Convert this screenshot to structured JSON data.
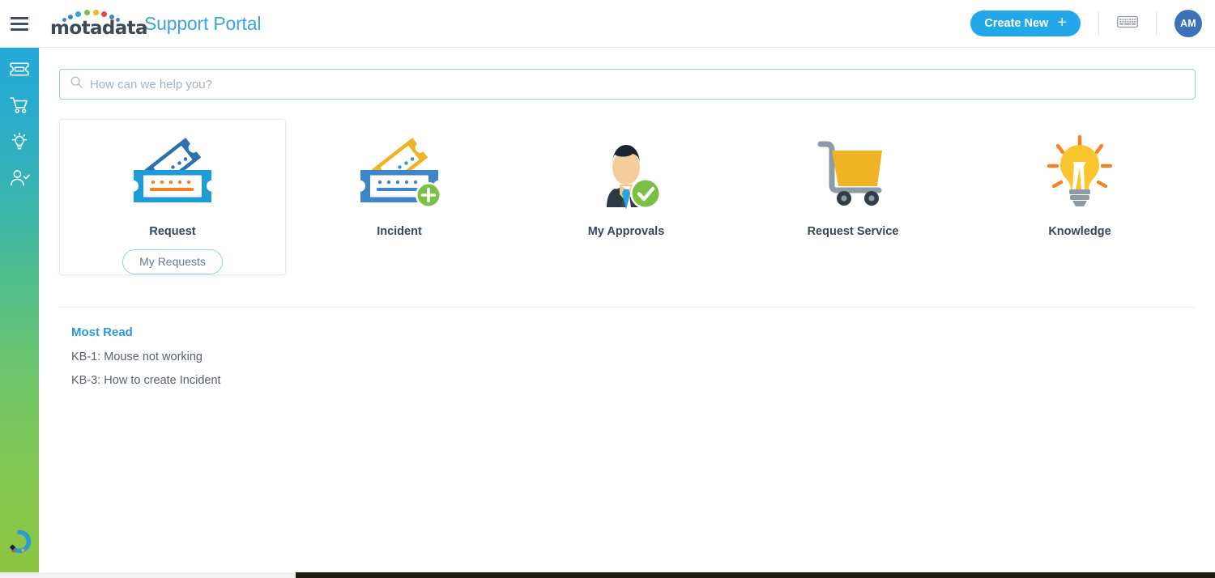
{
  "header": {
    "menu_icon": "hamburger-menu-icon",
    "logo_word": "motadata",
    "logo_dots_icon": "motadata-dots-logo-icon",
    "portal_title": "Support Portal",
    "create_new_label": "Create New",
    "create_new_plus": "+",
    "keyboard_icon": "keyboard-icon",
    "avatar_initials": "AM"
  },
  "sidebar": {
    "items": [
      {
        "name": "sidebar-item-tickets",
        "icon": "ticket-icon"
      },
      {
        "name": "sidebar-item-service-catalog",
        "icon": "shopping-cart-icon"
      },
      {
        "name": "sidebar-item-knowledge",
        "icon": "lightbulb-icon"
      },
      {
        "name": "sidebar-item-approvals",
        "icon": "user-check-icon"
      }
    ],
    "bottom_logo_icon": "motadata-circle-logo-icon"
  },
  "search": {
    "placeholder": "How can we help you?",
    "value": "",
    "icon": "search-icon"
  },
  "tiles": [
    {
      "label": "Request",
      "icon": "request-tickets-icon",
      "featured": true,
      "cta_label": "My Requests"
    },
    {
      "label": "Incident",
      "icon": "incident-ticket-plus-icon",
      "featured": false,
      "cta_label": ""
    },
    {
      "label": "My Approvals",
      "icon": "user-approval-check-icon",
      "featured": false,
      "cta_label": ""
    },
    {
      "label": "Request Service",
      "icon": "shopping-cart-icon",
      "featured": false,
      "cta_label": ""
    },
    {
      "label": "Knowledge",
      "icon": "lightbulb-idea-icon",
      "featured": false,
      "cta_label": ""
    }
  ],
  "most_read": {
    "heading": "Most Read",
    "articles": [
      "KB-1: Mouse not working",
      "KB-3: How to create Incident"
    ]
  },
  "colors": {
    "accent_blue": "#22a7e8",
    "title_blue": "#3aa3e3",
    "heading_blue": "#2b9ad6",
    "avatar_blue": "#3b72b8",
    "sidebar_top": "#24a8d8",
    "sidebar_bottom": "#8cc63f",
    "ticket_dark_blue": "#2c6fb5",
    "ticket_light_blue": "#1e9cd7",
    "ticket_yellow": "#f0b323",
    "cart_yellow": "#f0b323",
    "bulb_yellow": "#fbc52d",
    "ray_orange": "#f58220",
    "check_green": "#7ac143",
    "text_dark": "#37475a",
    "text_gray": "#57626c"
  }
}
